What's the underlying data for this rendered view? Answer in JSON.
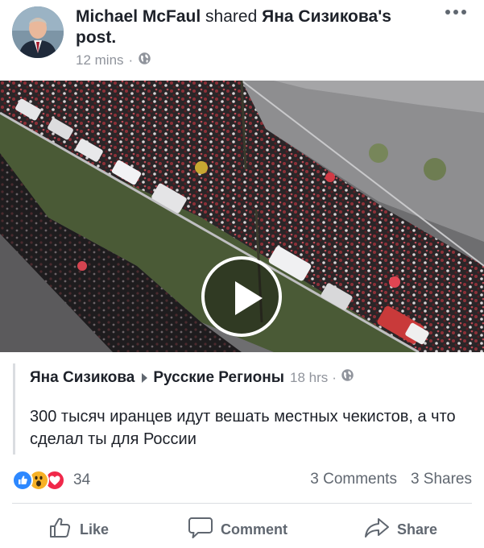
{
  "post": {
    "author": "Michael McFaul",
    "shared_word": "shared",
    "shared_from": "Яна Сизикова",
    "possessive": "'s",
    "object": "post.",
    "time": "12 mins",
    "dot": "·"
  },
  "shared_post": {
    "author": "Яна Сизикова",
    "target": "Русские Регионы",
    "time": "18 hrs",
    "dot": "·",
    "text": "300 тысяч иранцев идут вешать местных чекистов, а что сделал ты для России"
  },
  "stats": {
    "reactions_count": "34",
    "comments": "3 Comments",
    "shares": "3 Shares"
  },
  "actions": {
    "like": "Like",
    "comment": "Comment",
    "share": "Share"
  },
  "icons": {
    "more": "more-dots-icon",
    "privacy": "globe-icon",
    "play": "play-icon",
    "like": "thumbs-up-icon",
    "comment": "speech-bubble-icon",
    "share": "share-arrow-icon"
  },
  "colors": {
    "like_blue": "#2d88ff",
    "wow_yellow": "#f7b125",
    "love_red": "#f0284a",
    "meta_gray": "#90949c",
    "action_gray": "#606770"
  }
}
